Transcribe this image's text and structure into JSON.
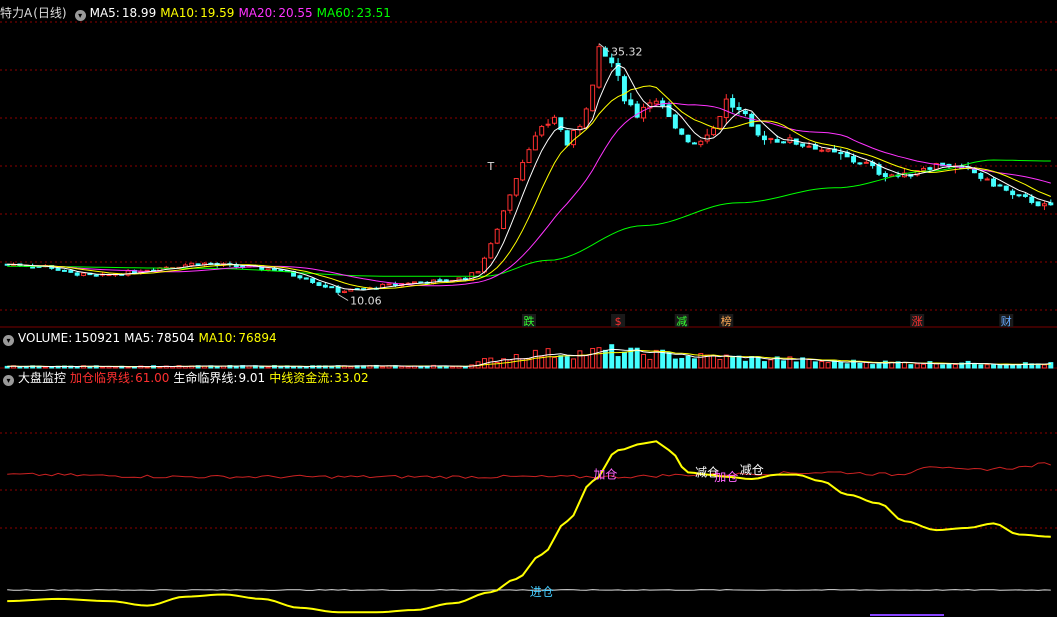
{
  "header": {
    "stock_name": "特力A",
    "period": "(日线)",
    "ma5_label": "MA5:",
    "ma5_value": "18.99",
    "ma10_label": "MA10:",
    "ma10_value": "19.59",
    "ma20_label": "MA20:",
    "ma20_value": "20.55",
    "ma60_label": "MA60:",
    "ma60_value": "23.51"
  },
  "volume_header": {
    "title": "VOLUME:",
    "value": "150921",
    "ma5_label": "MA5:",
    "ma5_value": "78504",
    "ma10_label": "MA10:",
    "ma10_value": "76894"
  },
  "indicator_header": {
    "title": "大盘监控",
    "add_label": "加仓临界线:",
    "add_value": "61.00",
    "life_label": "生命临界线:",
    "life_value": "9.01",
    "mid_label": "中线资金流:",
    "mid_value": "33.02"
  },
  "colors": {
    "ma5": "#ffffff",
    "ma10": "#ffff00",
    "ma20": "#ff33ff",
    "ma60": "#00ff00",
    "up": "#ff3030",
    "down": "#44ffff",
    "grid": "#8b0000",
    "signal_red": "#ff3030",
    "yellow": "#ffff00"
  },
  "chart_data": [
    {
      "type": "candlestick",
      "price_range": [
        8.5,
        37.5
      ],
      "annotations": [
        {
          "text": "35.32",
          "value": 35.32,
          "index": 93
        },
        {
          "text": "10.06",
          "value": 10.06,
          "index": 52
        },
        {
          "text": "T",
          "value": 22.6,
          "index": 76
        }
      ],
      "signals": [
        {
          "text": "跌",
          "index": 82,
          "color": "#33ff33"
        },
        {
          "text": "$",
          "index": 96,
          "color": "#ff3030"
        },
        {
          "text": "减",
          "index": 106,
          "color": "#33ff33"
        },
        {
          "text": "榜",
          "index": 113,
          "color": "#ffaa55"
        },
        {
          "text": "涨",
          "index": 143,
          "color": "#ff3030"
        },
        {
          "text": "财",
          "index": 157,
          "color": "#66aaff"
        }
      ],
      "ma_last": {
        "ma5": 18.99,
        "ma10": 19.59,
        "ma20": 20.55,
        "ma60": 23.51
      }
    },
    {
      "type": "bar",
      "name": "volume",
      "last_value": 150921,
      "ma5": 78504,
      "ma10": 76894
    },
    {
      "type": "line",
      "name": "indicator",
      "y_range": [
        0,
        100
      ],
      "series": [
        {
          "name": "加仓临界线",
          "color": "#cc2222",
          "last": 61.0
        },
        {
          "name": "生命临界线",
          "color": "#dddddd",
          "last": 9.01
        },
        {
          "name": "中线资金流",
          "color": "#ffff00",
          "last": 33.02
        }
      ],
      "mid_points": [
        [
          0,
          4
        ],
        [
          8,
          5
        ],
        [
          16,
          4
        ],
        [
          22,
          2
        ],
        [
          28,
          6
        ],
        [
          34,
          7
        ],
        [
          40,
          5
        ],
        [
          46,
          1
        ],
        [
          52,
          -1
        ],
        [
          58,
          -1
        ],
        [
          64,
          0
        ],
        [
          70,
          3
        ],
        [
          76,
          8
        ],
        [
          80,
          14
        ],
        [
          84,
          25
        ],
        [
          88,
          40
        ],
        [
          92,
          58
        ],
        [
          96,
          72
        ],
        [
          100,
          75
        ],
        [
          102,
          76
        ],
        [
          104,
          72
        ],
        [
          107,
          62
        ],
        [
          110,
          61
        ],
        [
          113,
          60
        ],
        [
          117,
          59
        ],
        [
          121,
          61
        ],
        [
          124,
          61
        ],
        [
          128,
          58
        ],
        [
          132,
          52
        ],
        [
          137,
          48
        ],
        [
          141,
          40
        ],
        [
          146,
          36
        ],
        [
          151,
          37
        ],
        [
          155,
          39
        ],
        [
          159,
          34
        ],
        [
          164,
          33
        ]
      ],
      "labels": [
        {
          "text": "进仓",
          "index": 84,
          "value": 8,
          "color": "#44ccff"
        },
        {
          "text": "加仓",
          "index": 94,
          "value": 61,
          "color": "#ff66ff"
        },
        {
          "text": "减仓",
          "index": 110,
          "value": 62,
          "color": "#ffffff"
        },
        {
          "text": "加仓",
          "index": 113,
          "value": 60,
          "color": "#ff66ff"
        },
        {
          "text": "减仓",
          "index": 117,
          "value": 63,
          "color": "#ffffff"
        }
      ]
    }
  ]
}
